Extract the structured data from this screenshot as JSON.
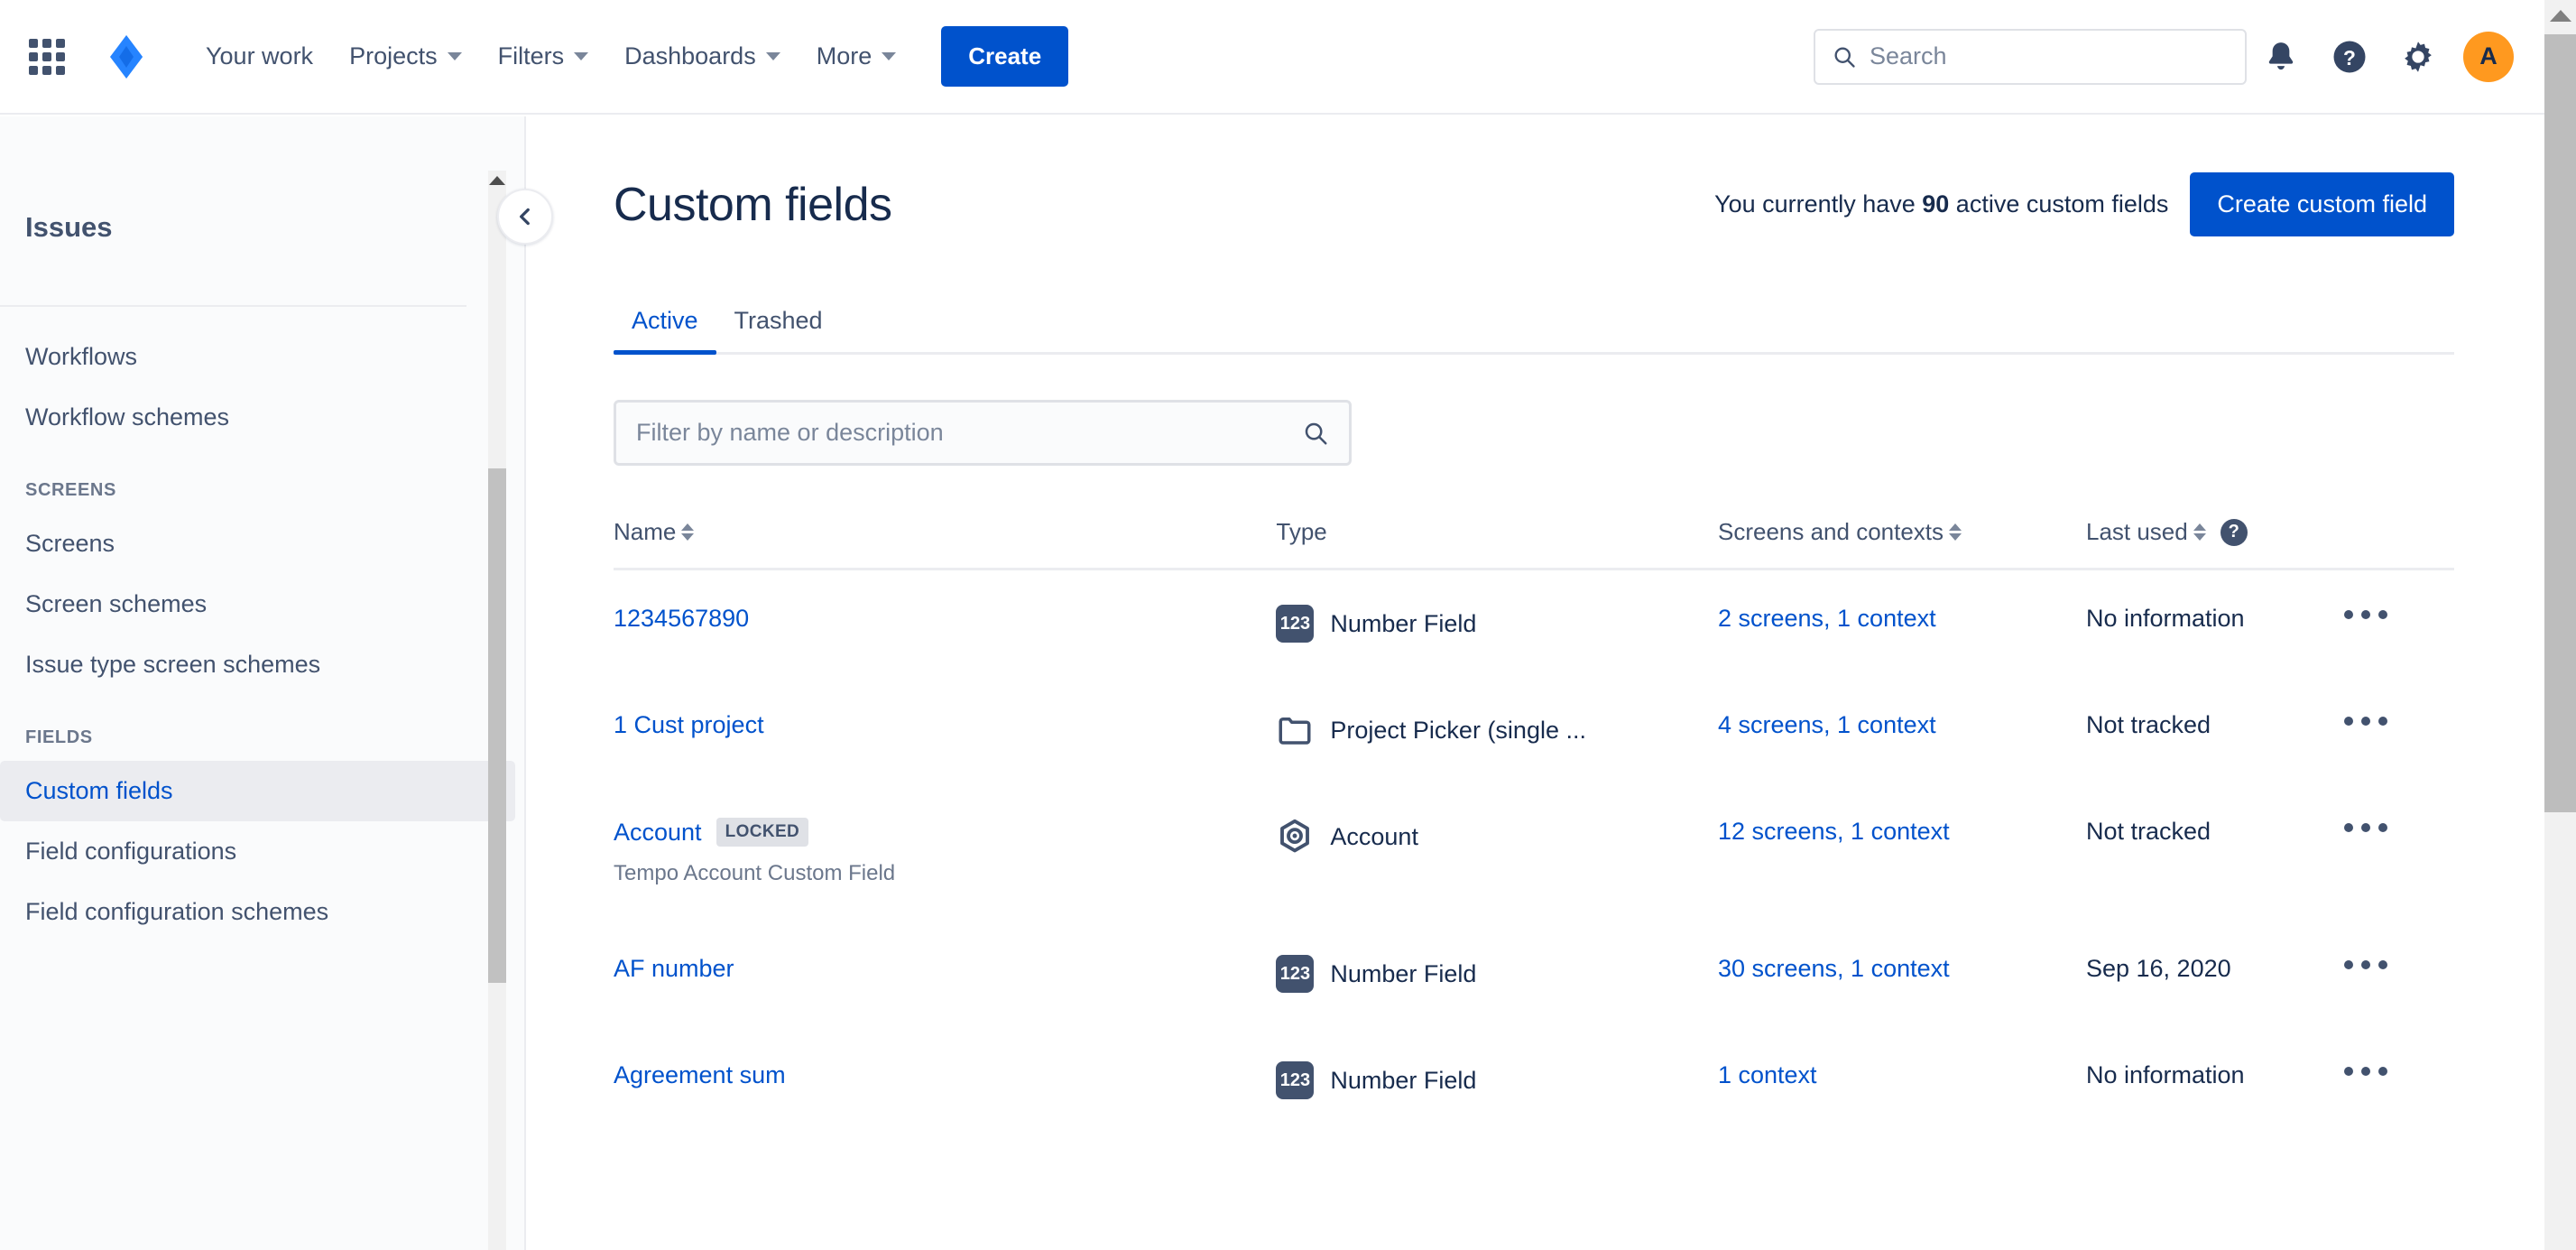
{
  "topnav": {
    "app_switcher": "app-switcher",
    "logo": "jira-logo",
    "items": [
      {
        "label": "Your work",
        "has_chevron": false
      },
      {
        "label": "Projects",
        "has_chevron": true
      },
      {
        "label": "Filters",
        "has_chevron": true
      },
      {
        "label": "Dashboards",
        "has_chevron": true
      },
      {
        "label": "More",
        "has_chevron": true
      }
    ],
    "create_label": "Create",
    "search_placeholder": "Search",
    "avatar_initial": "A",
    "avatar_color": "#ff991f",
    "accent_color": "#0052cc"
  },
  "sidebar": {
    "title": "Issues",
    "groups": [
      {
        "section": null,
        "items": [
          {
            "label": "Workflows",
            "selected": false
          },
          {
            "label": "Workflow schemes",
            "selected": false
          }
        ]
      },
      {
        "section": "SCREENS",
        "items": [
          {
            "label": "Screens",
            "selected": false
          },
          {
            "label": "Screen schemes",
            "selected": false
          },
          {
            "label": "Issue type screen schemes",
            "selected": false
          }
        ]
      },
      {
        "section": "FIELDS",
        "items": [
          {
            "label": "Custom fields",
            "selected": true
          },
          {
            "label": "Field configurations",
            "selected": false
          },
          {
            "label": "Field configuration schemes",
            "selected": false
          }
        ]
      }
    ]
  },
  "main": {
    "title": "Custom fields",
    "count_prefix": "You currently have ",
    "count_value": "90",
    "count_suffix": " active custom fields",
    "create_button": "Create custom field",
    "tabs": [
      {
        "label": "Active",
        "active": true
      },
      {
        "label": "Trashed",
        "active": false
      }
    ],
    "filter_placeholder": "Filter by name or description",
    "columns": [
      {
        "label": "Name",
        "sortable": true,
        "help": false
      },
      {
        "label": "Type",
        "sortable": false,
        "help": false
      },
      {
        "label": "Screens and contexts",
        "sortable": true,
        "help": false
      },
      {
        "label": "Last used",
        "sortable": true,
        "help": true
      }
    ],
    "rows": [
      {
        "name": "1234567890",
        "locked": false,
        "description": null,
        "type": "Number Field",
        "type_icon": "number-123-icon",
        "screens_contexts": "2 screens, 1 context",
        "last_used": "No information"
      },
      {
        "name": "1 Cust project",
        "locked": false,
        "description": null,
        "type": "Project Picker (single ...",
        "type_icon": "folder-icon",
        "screens_contexts": "4 screens, 1 context",
        "last_used": "Not tracked"
      },
      {
        "name": "Account",
        "locked": true,
        "locked_label": "LOCKED",
        "description": "Tempo Account Custom Field",
        "type": "Account",
        "type_icon": "account-hexagon-icon",
        "screens_contexts": "12 screens, 1 context",
        "last_used": "Not tracked"
      },
      {
        "name": "AF number",
        "locked": false,
        "description": null,
        "type": "Number Field",
        "type_icon": "number-123-icon",
        "screens_contexts": "30 screens, 1 context",
        "last_used": "Sep 16, 2020"
      },
      {
        "name": "Agreement sum",
        "locked": false,
        "description": null,
        "type": "Number Field",
        "type_icon": "number-123-icon",
        "screens_contexts": "1 context",
        "last_used": "No information"
      }
    ]
  }
}
